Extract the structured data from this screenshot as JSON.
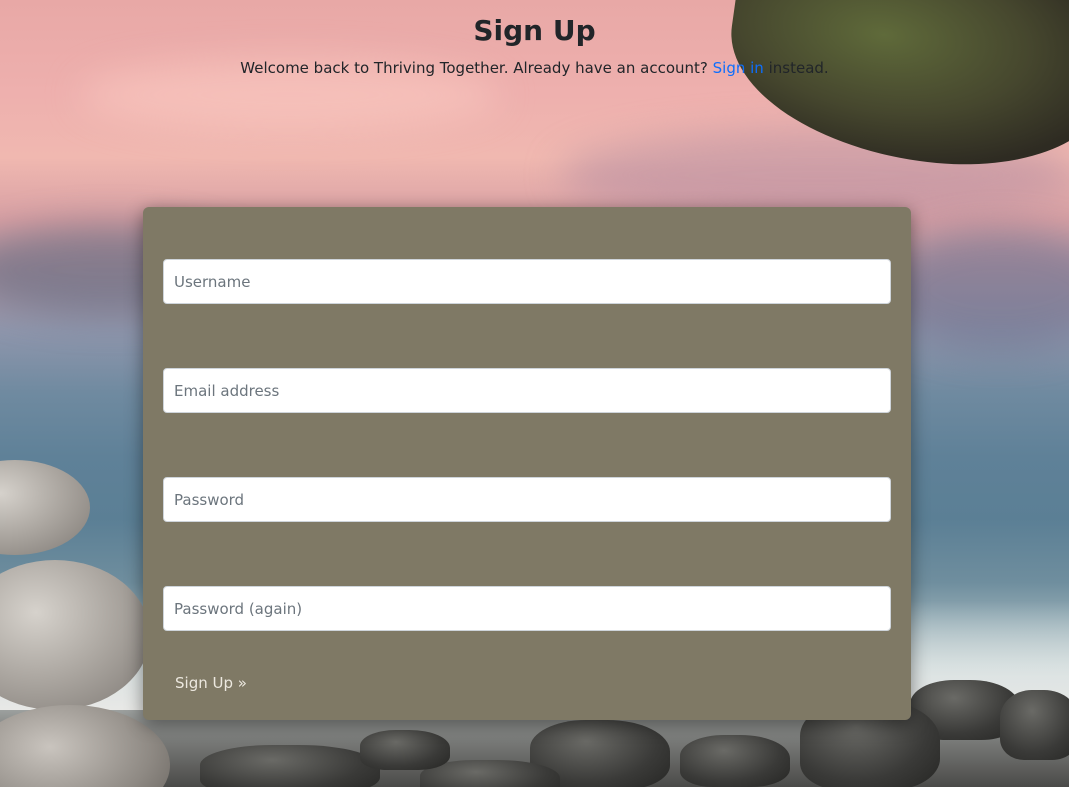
{
  "header": {
    "title": "Sign Up",
    "subtitle_before": "Welcome back to Thriving Together. Already have an account?",
    "signin_link": "Sign in",
    "subtitle_after": "instead."
  },
  "form": {
    "username_placeholder": "Username",
    "email_placeholder": "Email address",
    "password_placeholder": "Password",
    "password_again_placeholder": "Password (again)",
    "submit_label": "Sign Up »"
  },
  "colors": {
    "card_background": "#7f7965",
    "link": "#0d6efd",
    "title_text": "#212529",
    "button_text": "#ece8df"
  },
  "background": {
    "scene": "seaside-rocks-pink-sky"
  }
}
